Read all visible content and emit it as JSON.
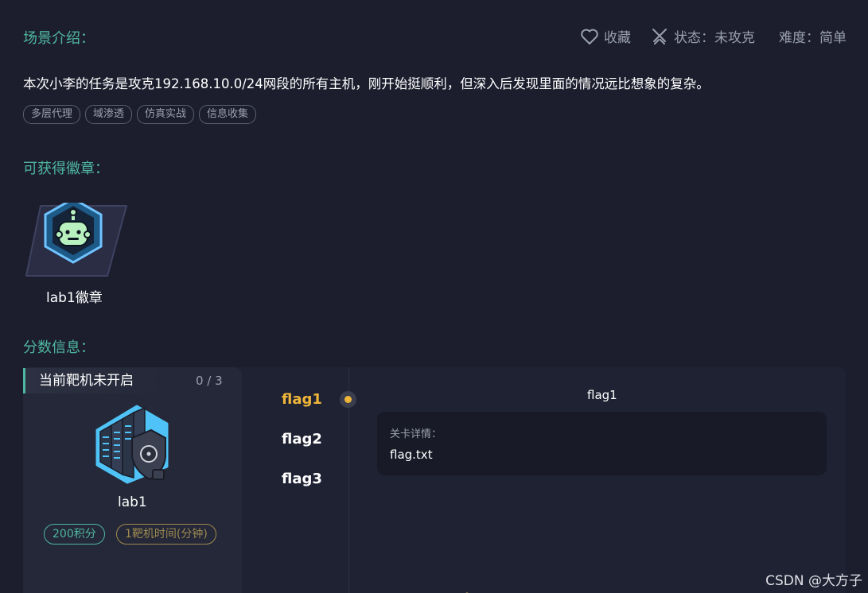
{
  "header": {
    "favorite_label": "收藏",
    "status_label": "状态：未攻克",
    "difficulty_label": "难度：简单"
  },
  "intro": {
    "title": "场景介绍：",
    "description": "本次小李的任务是攻克192.168.10.0/24网段的所有主机，刚开始挺顺利，但深入后发现里面的情况远比想象的复杂。",
    "tags": [
      "多层代理",
      "域渗透",
      "仿真实战",
      "信息收集"
    ]
  },
  "badges": {
    "title": "可获得徽章：",
    "items": [
      {
        "label": "lab1徽章",
        "icon": "robot-badge-icon"
      }
    ]
  },
  "score": {
    "title": "分数信息：",
    "machine_status": "当前靶机未开启",
    "progress": "0 / 3",
    "machine_name": "lab1",
    "points": "200积分",
    "time": "1靶机时间(分钟)",
    "flags": [
      "flag1",
      "flag2",
      "flag3"
    ],
    "active_flag_index": 0,
    "detail": {
      "title": "flag1",
      "label": "关卡详情：",
      "value": "flag.txt"
    }
  },
  "watermark": "CSDN @大方子",
  "colors": {
    "accent": "#4fb7a0",
    "active_flag": "#f0b63a",
    "background": "#1c1e2e"
  }
}
